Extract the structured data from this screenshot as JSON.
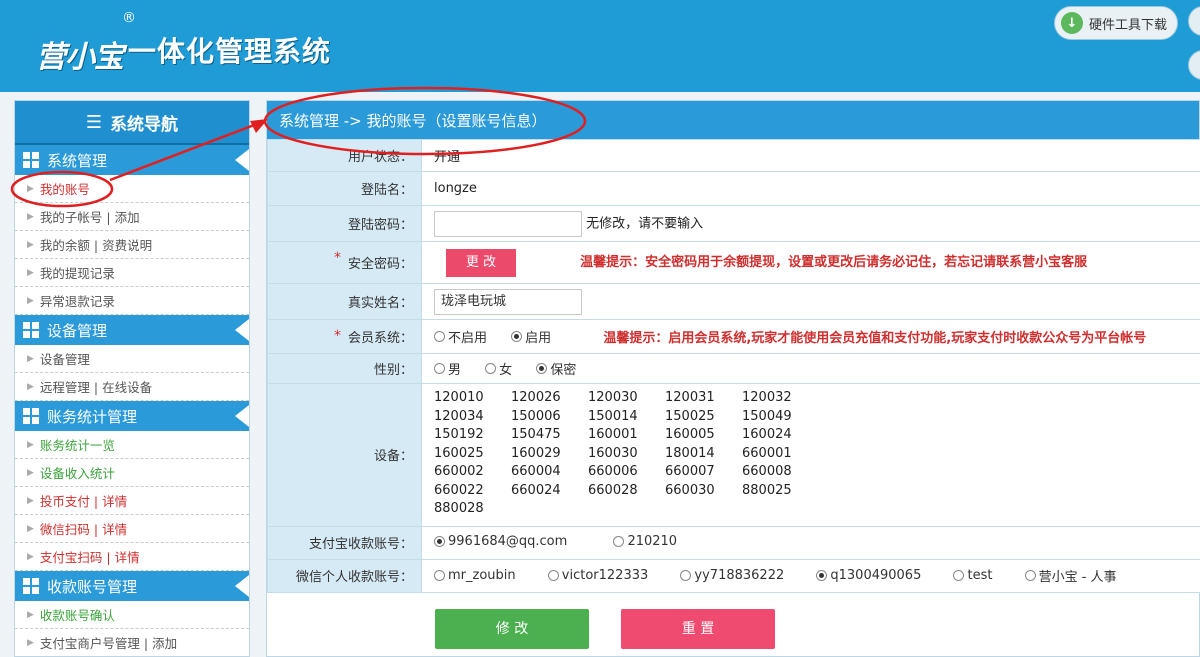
{
  "header": {
    "logo_text": "营小宝",
    "logo_mark": "®",
    "title": "一体化管理系统",
    "download_label": "硬件工具下载"
  },
  "sidebar": {
    "title": "系统导航",
    "sections": [
      {
        "label": "系统管理",
        "items": [
          "我的账号",
          "我的子帐号 | 添加",
          "我的余额 | 资费说明",
          "我的提现记录",
          "异常退款记录"
        ]
      },
      {
        "label": "设备管理",
        "items": [
          "设备管理",
          "远程管理 | 在线设备"
        ]
      },
      {
        "label": "账务统计管理",
        "items": [
          "账务统计一览",
          "设备收入统计",
          "投币支付 | 详情",
          "微信扫码 | 详情",
          "支付宝扫码 | 详情"
        ]
      },
      {
        "label": "收款账号管理",
        "items": [
          "收款账号确认",
          "支付宝商户号管理 | 添加"
        ]
      }
    ]
  },
  "breadcrumb": "系统管理 -> 我的账号（设置账号信息）",
  "form": {
    "status_label": "用户状态：",
    "status_value": "开通",
    "login_label": "登陆名：",
    "login_value": "longze",
    "password_label": "登陆密码：",
    "password_hint": "无修改，请不要输入",
    "safe_pwd_label": "安全密码：",
    "safe_pwd_button": "更 改",
    "safe_pwd_tip": "温馨提示：安全密码用于余额提现，设置或更改后请务必记住，若忘记请联系营小宝客服",
    "realname_label": "真实姓名：",
    "realname_value": "珑泽电玩城",
    "member_label": "会员系统：",
    "member_options": [
      "不启用",
      "启用"
    ],
    "member_selected": "启用",
    "member_tip": "温馨提示：启用会员系统,玩家才能使用会员充值和支付功能,玩家支付时收款公众号为平台帐号",
    "gender_label": "性别：",
    "gender_options": [
      "男",
      "女",
      "保密"
    ],
    "gender_selected": "保密",
    "devices_label": "设备：",
    "devices": [
      "120010",
      "120026",
      "120030",
      "120031",
      "120032",
      "120034",
      "150006",
      "150014",
      "150025",
      "150049",
      "150192",
      "150475",
      "160001",
      "160005",
      "160024",
      "160025",
      "160029",
      "160030",
      "180014",
      "660001",
      "660002",
      "660004",
      "660006",
      "660007",
      "660008",
      "660022",
      "660024",
      "660028",
      "660030",
      "880025",
      "880028"
    ],
    "alipay_label": "支付宝收款账号：",
    "alipay_options": [
      "9961684@qq.com",
      "210210"
    ],
    "alipay_selected": "9961684@qq.com",
    "wechat_label": "微信个人收款账号：",
    "wechat_options": [
      "mr_zoubin",
      "victor122333",
      "yy718836222",
      "q1300490065",
      "test",
      "营小宝 - 人事"
    ],
    "wechat_selected": "q1300490065",
    "save_button": "修 改",
    "reset_button": "重 置"
  },
  "colors": {
    "header_bg": "#1f9bd6",
    "nav_blue": "#2a9ad8",
    "label_bg": "#d6eaf6",
    "save_green": "#4cb050",
    "reset_pink": "#ef4a70",
    "tip_red": "#d02f2f",
    "annotation_red": "#e02020"
  },
  "icons": {
    "download": "download-icon",
    "nav": "menu-icon",
    "section": "grid-icon",
    "item": "triangle-right-icon"
  }
}
